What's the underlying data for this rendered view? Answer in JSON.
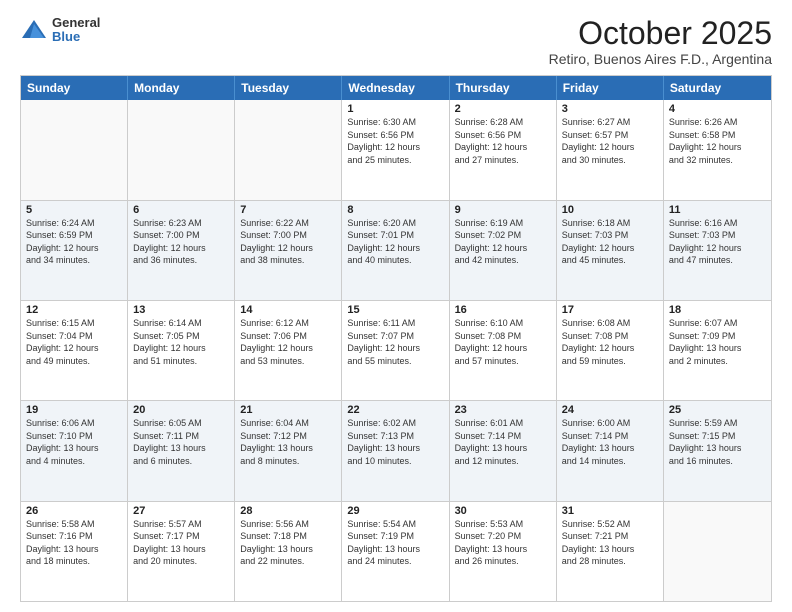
{
  "header": {
    "logo_general": "General",
    "logo_blue": "Blue",
    "month_title": "October 2025",
    "subtitle": "Retiro, Buenos Aires F.D., Argentina"
  },
  "day_headers": [
    "Sunday",
    "Monday",
    "Tuesday",
    "Wednesday",
    "Thursday",
    "Friday",
    "Saturday"
  ],
  "weeks": [
    {
      "days": [
        {
          "num": "",
          "info": "",
          "empty": true
        },
        {
          "num": "",
          "info": "",
          "empty": true
        },
        {
          "num": "",
          "info": "",
          "empty": true
        },
        {
          "num": "1",
          "info": "Sunrise: 6:30 AM\nSunset: 6:56 PM\nDaylight: 12 hours\nand 25 minutes."
        },
        {
          "num": "2",
          "info": "Sunrise: 6:28 AM\nSunset: 6:56 PM\nDaylight: 12 hours\nand 27 minutes."
        },
        {
          "num": "3",
          "info": "Sunrise: 6:27 AM\nSunset: 6:57 PM\nDaylight: 12 hours\nand 30 minutes."
        },
        {
          "num": "4",
          "info": "Sunrise: 6:26 AM\nSunset: 6:58 PM\nDaylight: 12 hours\nand 32 minutes."
        }
      ]
    },
    {
      "days": [
        {
          "num": "5",
          "info": "Sunrise: 6:24 AM\nSunset: 6:59 PM\nDaylight: 12 hours\nand 34 minutes."
        },
        {
          "num": "6",
          "info": "Sunrise: 6:23 AM\nSunset: 7:00 PM\nDaylight: 12 hours\nand 36 minutes."
        },
        {
          "num": "7",
          "info": "Sunrise: 6:22 AM\nSunset: 7:00 PM\nDaylight: 12 hours\nand 38 minutes."
        },
        {
          "num": "8",
          "info": "Sunrise: 6:20 AM\nSunset: 7:01 PM\nDaylight: 12 hours\nand 40 minutes."
        },
        {
          "num": "9",
          "info": "Sunrise: 6:19 AM\nSunset: 7:02 PM\nDaylight: 12 hours\nand 42 minutes."
        },
        {
          "num": "10",
          "info": "Sunrise: 6:18 AM\nSunset: 7:03 PM\nDaylight: 12 hours\nand 45 minutes."
        },
        {
          "num": "11",
          "info": "Sunrise: 6:16 AM\nSunset: 7:03 PM\nDaylight: 12 hours\nand 47 minutes."
        }
      ]
    },
    {
      "days": [
        {
          "num": "12",
          "info": "Sunrise: 6:15 AM\nSunset: 7:04 PM\nDaylight: 12 hours\nand 49 minutes."
        },
        {
          "num": "13",
          "info": "Sunrise: 6:14 AM\nSunset: 7:05 PM\nDaylight: 12 hours\nand 51 minutes."
        },
        {
          "num": "14",
          "info": "Sunrise: 6:12 AM\nSunset: 7:06 PM\nDaylight: 12 hours\nand 53 minutes."
        },
        {
          "num": "15",
          "info": "Sunrise: 6:11 AM\nSunset: 7:07 PM\nDaylight: 12 hours\nand 55 minutes."
        },
        {
          "num": "16",
          "info": "Sunrise: 6:10 AM\nSunset: 7:08 PM\nDaylight: 12 hours\nand 57 minutes."
        },
        {
          "num": "17",
          "info": "Sunrise: 6:08 AM\nSunset: 7:08 PM\nDaylight: 12 hours\nand 59 minutes."
        },
        {
          "num": "18",
          "info": "Sunrise: 6:07 AM\nSunset: 7:09 PM\nDaylight: 13 hours\nand 2 minutes."
        }
      ]
    },
    {
      "days": [
        {
          "num": "19",
          "info": "Sunrise: 6:06 AM\nSunset: 7:10 PM\nDaylight: 13 hours\nand 4 minutes."
        },
        {
          "num": "20",
          "info": "Sunrise: 6:05 AM\nSunset: 7:11 PM\nDaylight: 13 hours\nand 6 minutes."
        },
        {
          "num": "21",
          "info": "Sunrise: 6:04 AM\nSunset: 7:12 PM\nDaylight: 13 hours\nand 8 minutes."
        },
        {
          "num": "22",
          "info": "Sunrise: 6:02 AM\nSunset: 7:13 PM\nDaylight: 13 hours\nand 10 minutes."
        },
        {
          "num": "23",
          "info": "Sunrise: 6:01 AM\nSunset: 7:14 PM\nDaylight: 13 hours\nand 12 minutes."
        },
        {
          "num": "24",
          "info": "Sunrise: 6:00 AM\nSunset: 7:14 PM\nDaylight: 13 hours\nand 14 minutes."
        },
        {
          "num": "25",
          "info": "Sunrise: 5:59 AM\nSunset: 7:15 PM\nDaylight: 13 hours\nand 16 minutes."
        }
      ]
    },
    {
      "days": [
        {
          "num": "26",
          "info": "Sunrise: 5:58 AM\nSunset: 7:16 PM\nDaylight: 13 hours\nand 18 minutes."
        },
        {
          "num": "27",
          "info": "Sunrise: 5:57 AM\nSunset: 7:17 PM\nDaylight: 13 hours\nand 20 minutes."
        },
        {
          "num": "28",
          "info": "Sunrise: 5:56 AM\nSunset: 7:18 PM\nDaylight: 13 hours\nand 22 minutes."
        },
        {
          "num": "29",
          "info": "Sunrise: 5:54 AM\nSunset: 7:19 PM\nDaylight: 13 hours\nand 24 minutes."
        },
        {
          "num": "30",
          "info": "Sunrise: 5:53 AM\nSunset: 7:20 PM\nDaylight: 13 hours\nand 26 minutes."
        },
        {
          "num": "31",
          "info": "Sunrise: 5:52 AM\nSunset: 7:21 PM\nDaylight: 13 hours\nand 28 minutes."
        },
        {
          "num": "",
          "info": "",
          "empty": true
        }
      ]
    }
  ]
}
